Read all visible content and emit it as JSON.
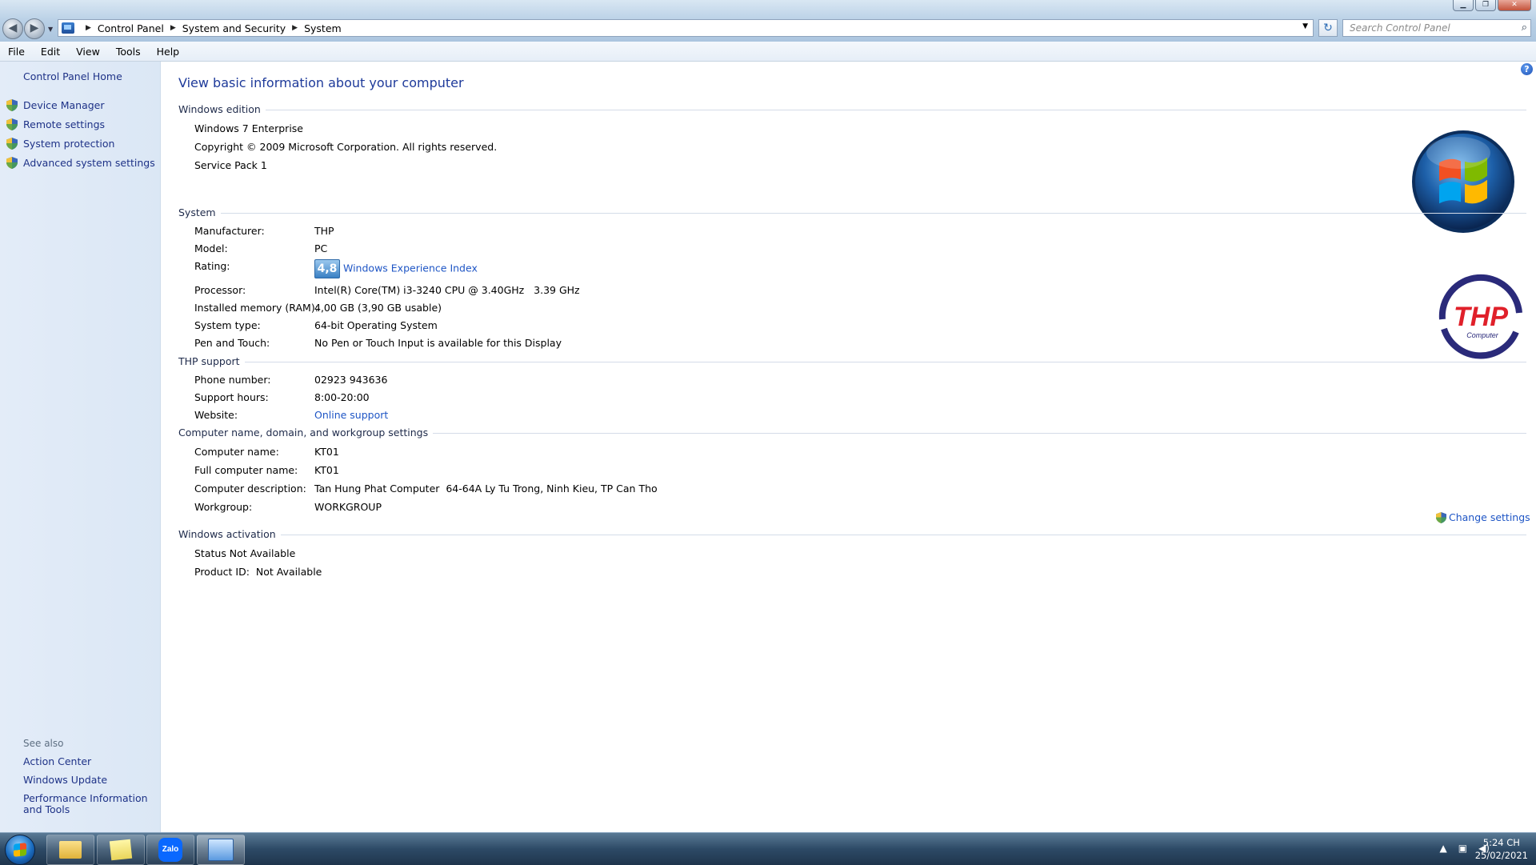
{
  "window": {
    "breadcrumbs": [
      "Control Panel",
      "System and Security",
      "System"
    ],
    "search_placeholder": "Search Control Panel"
  },
  "menu": [
    "File",
    "Edit",
    "View",
    "Tools",
    "Help"
  ],
  "left_pane": {
    "home": "Control Panel Home",
    "tasks": [
      "Device Manager",
      "Remote settings",
      "System protection",
      "Advanced system settings"
    ],
    "see_also_title": "See also",
    "see_also": [
      "Action Center",
      "Windows Update",
      "Performance Information and Tools"
    ]
  },
  "main": {
    "title": "View basic information about your computer",
    "edition": {
      "heading": "Windows edition",
      "name": "Windows 7 Enterprise",
      "copyright": "Copyright © 2009 Microsoft Corporation.  All rights reserved.",
      "service_pack": "Service Pack 1"
    },
    "system": {
      "heading": "System",
      "manufacturer_label": "Manufacturer:",
      "manufacturer": "THP",
      "model_label": "Model:",
      "model": "PC",
      "rating_label": "Rating:",
      "rating_score": "4,8",
      "rating_link": "Windows Experience Index",
      "processor_label": "Processor:",
      "processor": "Intel(R) Core(TM) i3-3240 CPU @ 3.40GHz   3.39 GHz",
      "ram_label": "Installed memory (RAM):",
      "ram": "4,00 GB (3,90 GB usable)",
      "type_label": "System type:",
      "type": "64-bit Operating System",
      "pen_label": "Pen and Touch:",
      "pen": "No Pen or Touch Input is available for this Display"
    },
    "support": {
      "heading": "THP support",
      "phone_label": "Phone number:",
      "phone": "02923 943636",
      "hours_label": "Support hours:",
      "hours": "8:00-20:00",
      "website_label": "Website:",
      "website": "Online support"
    },
    "computer_name": {
      "heading": "Computer name, domain, and workgroup settings",
      "name_label": "Computer name:",
      "name": "KT01",
      "full_label": "Full computer name:",
      "full": "KT01",
      "desc_label": "Computer description:",
      "desc": "Tan Hung Phat Computer  64-64A Ly Tu Trong, Ninh Kieu, TP Can Tho",
      "workgroup_label": "Workgroup:",
      "workgroup": "WORKGROUP",
      "change_settings": "Change settings"
    },
    "activation": {
      "heading": "Windows activation",
      "status": "Status Not Available",
      "product_id": "Product ID:  Not Available"
    },
    "oem_logo_text": "THP",
    "oem_logo_sub": "Computer"
  },
  "taskbar": {
    "zalo": "Zalo",
    "time": "5:24 CH",
    "date": "25/02/2021"
  },
  "colors": {
    "link": "#1e55c5",
    "heading": "#1e3a9a",
    "thp_red": "#e0202a",
    "thp_navy": "#2a2a7a"
  }
}
